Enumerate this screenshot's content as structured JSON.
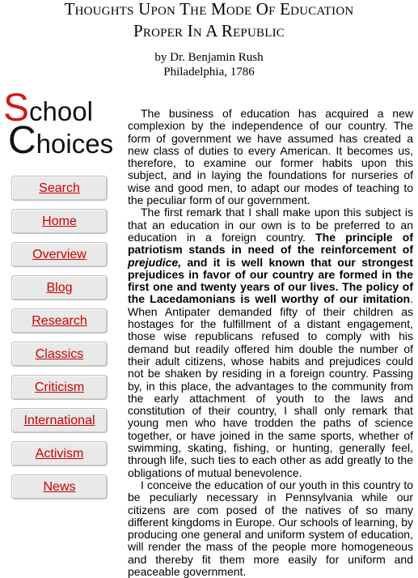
{
  "header": {
    "title_line1": "Thoughts Upon The Mode Of Education",
    "title_line2": "Proper In A Republic",
    "author": "by Dr. Benjamin Rush",
    "place_date": "Philadelphia, 1786"
  },
  "logo": {
    "word1_initial": "S",
    "word1_rest": "chool",
    "word2_initial": "C",
    "word2_rest": "hoices",
    "accent_color": "#d11a1a"
  },
  "nav": {
    "items": [
      {
        "label": "Search"
      },
      {
        "label": "Home"
      },
      {
        "label": "Overview"
      },
      {
        "label": "Blog"
      },
      {
        "label": "Research"
      },
      {
        "label": "Classics"
      },
      {
        "label": "Criticism"
      },
      {
        "label": "International"
      },
      {
        "label": "Activism"
      },
      {
        "label": "News"
      }
    ],
    "link_color": "#cc0000"
  },
  "article": {
    "p1": "The business of education has acquired a new complexion by the independence of our country. The form of government we have assumed has created a new class of duties to every American. It becomes us, therefore, to examine our former habits upon this subject, and in laying the foundations for nurseries of wise and good men, to adapt our modes of teaching to the peculiar form of our government.",
    "p2_a": "The first remark that I shall make upon this subject is that an education in our own is to be preferred to an education in a foreign country.",
    "p2_bold1": "The principle of patriotism stands in need of the reinforcement of",
    "p2_bold_italic": "prejudice,",
    "p2_bold2": "and it is well known that our strongest prejudices in favor of our country are formed in the first one and twenty years of our lives. The policy of the Lacedamonians is well worthy of our imitation",
    "p2_b": ". When Antipater demanded fifty of their children as hostages for the fulfillment of a distant engagement, those wise republicans refused to comply with his demand but readily offered him double the number of their adult citizens, whose habits and prejudices could not be shaken by residing in a foreign country. Passing by, in this place, the advantages to the community from the early attachment of youth to the laws and constitution of their country, I shall only remark that young men who have trodden the paths of science together, or have joined in the same sports, whether of swimming, skating, fishing, or hunting, generally feel, through life, such ties to each other as add greatly to the obligations of mutual benevolence.",
    "p3": "I conceive the education of our youth in this country to be peculiarly necessary in Pennsylvania while our citizens are com posed of the natives of so many different kingdoms in Europe. Our schools of learning, by producing one general and uniform system of education, will render the mass of the people more homogeneous and thereby fit them more easily for uniform and peaceable government."
  }
}
